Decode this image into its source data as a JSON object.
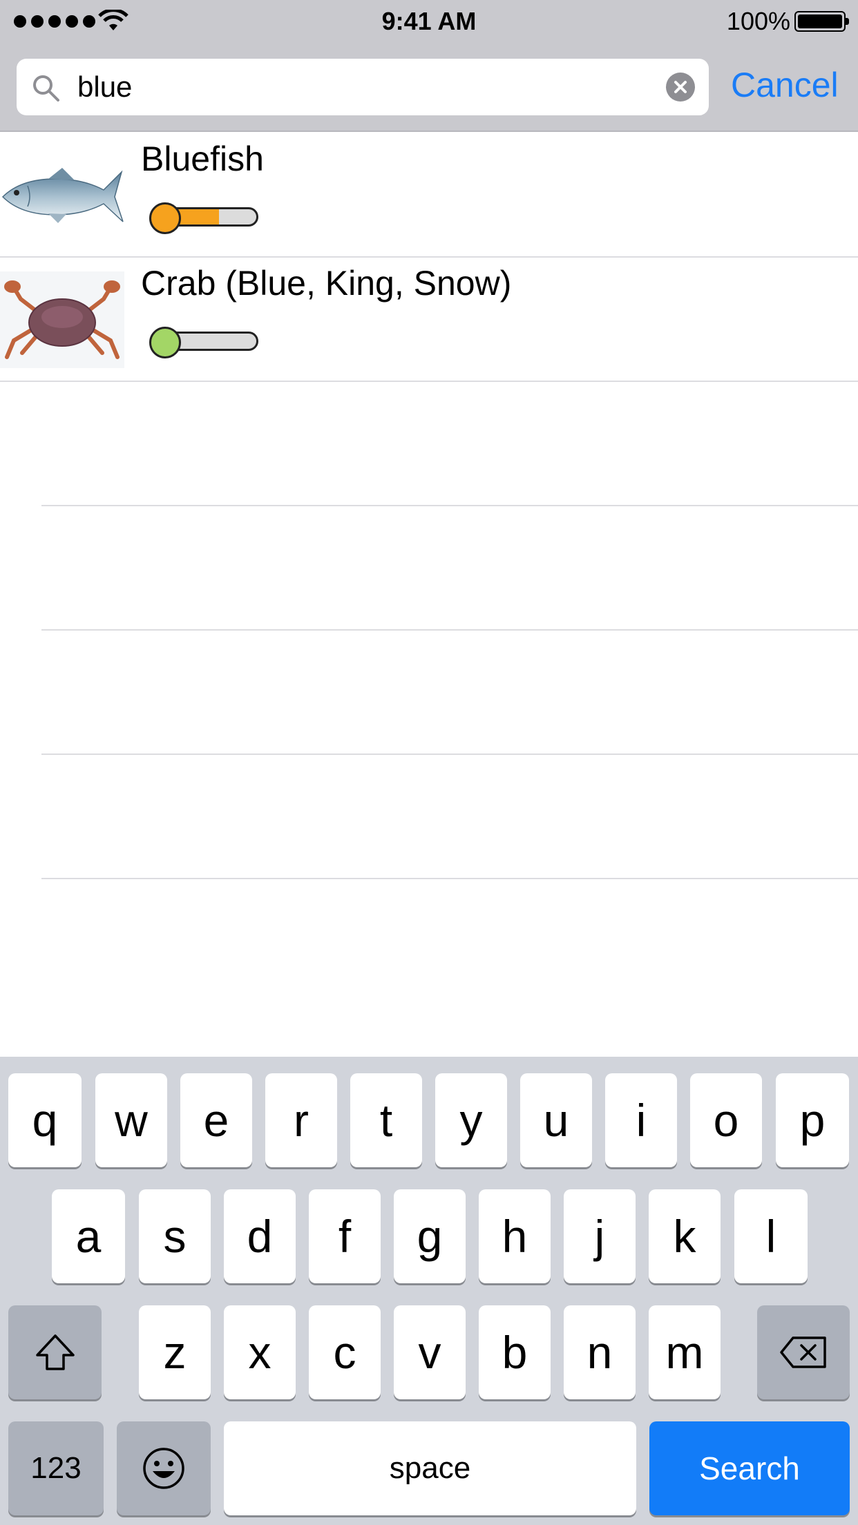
{
  "status_bar": {
    "time": "9:41 AM",
    "battery_percent": "100%",
    "signal_bars": 5,
    "battery_level": 1.0
  },
  "search": {
    "query": "blue",
    "cancel_label": "Cancel"
  },
  "results": [
    {
      "title": "Bluefish",
      "thumb_icon": "bluefish-photo",
      "meter_color": "#f6a21e",
      "meter_level": 0.6
    },
    {
      "title": "Crab (Blue, King, Snow)",
      "thumb_icon": "crab-photo",
      "meter_color": "#a3d666",
      "meter_level": 0.12
    }
  ],
  "keyboard": {
    "row1": [
      "q",
      "w",
      "e",
      "r",
      "t",
      "y",
      "u",
      "i",
      "o",
      "p"
    ],
    "row2": [
      "a",
      "s",
      "d",
      "f",
      "g",
      "h",
      "j",
      "k",
      "l"
    ],
    "row3": [
      "z",
      "x",
      "c",
      "v",
      "b",
      "n",
      "m"
    ],
    "numbers_label": "123",
    "space_label": "space",
    "search_label": "Search"
  },
  "colors": {
    "accent": "#1a7cf6",
    "search_key": "#127cf8"
  }
}
